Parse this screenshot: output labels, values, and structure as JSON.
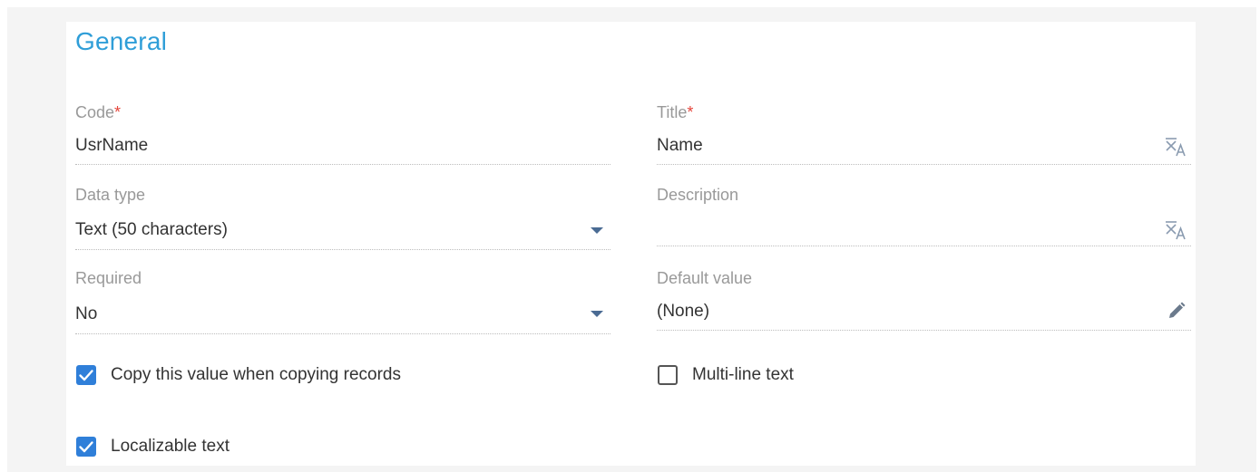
{
  "section": {
    "title": "General"
  },
  "fields": {
    "code": {
      "label": "Code",
      "required_mark": "*",
      "value": "UsrName"
    },
    "title": {
      "label": "Title",
      "required_mark": "*",
      "value": "Name"
    },
    "data_type": {
      "label": "Data type",
      "value": "Text (50 characters)"
    },
    "description": {
      "label": "Description",
      "value": ""
    },
    "required": {
      "label": "Required",
      "value": "No"
    },
    "default_value": {
      "label": "Default value",
      "value": "(None)"
    }
  },
  "checkboxes": {
    "copy_value": {
      "label": "Copy this value when copying records",
      "checked": true
    },
    "multiline": {
      "label": "Multi-line text",
      "checked": false
    },
    "localizable": {
      "label": "Localizable text",
      "checked": true
    }
  },
  "icons": {
    "translate": "translate-icon",
    "dropdown": "chevron-down-icon",
    "edit": "pencil-icon",
    "check": "check-icon"
  },
  "colors": {
    "accent": "#2f9ed8",
    "checkbox": "#2f7fd9",
    "required": "#e5453b",
    "arrow": "#4a6b93"
  }
}
